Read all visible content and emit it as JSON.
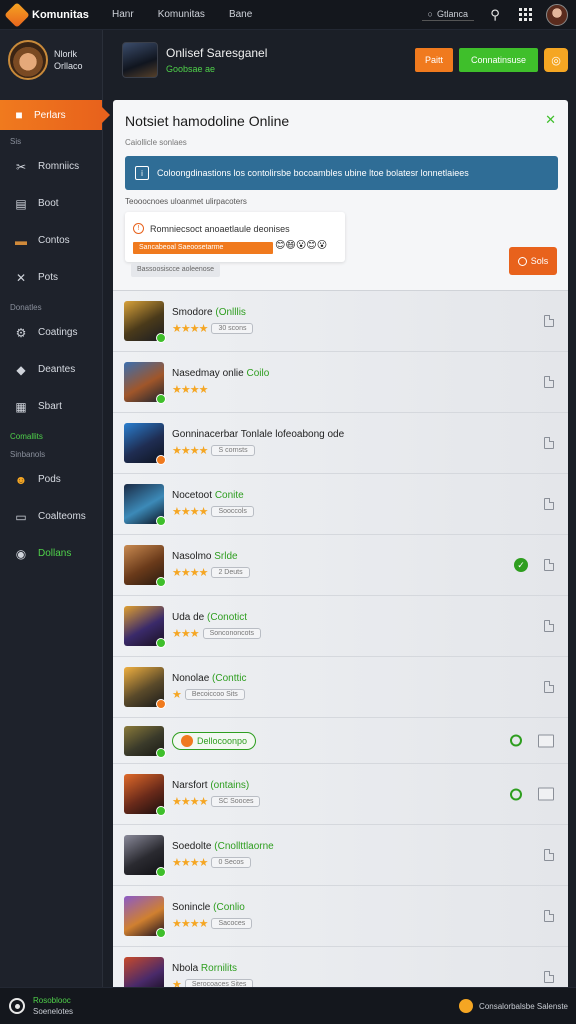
{
  "topbar": {
    "brand": "Komunitas",
    "nav": [
      "Hanr",
      "Komunitas",
      "Bane"
    ],
    "search_label": "Gtlanca"
  },
  "sidebar": {
    "profile_name_line1": "Nlorlk",
    "profile_name_line2": "Orllaco",
    "active_item": "Perlars",
    "section1": "Sis",
    "items_a": [
      {
        "label": "Romniics",
        "icon": "wrench-icon"
      },
      {
        "label": "Boot",
        "icon": "book-icon"
      },
      {
        "label": "Contos",
        "icon": "folder-icon"
      },
      {
        "label": "Pots",
        "icon": "tools-icon"
      }
    ],
    "section2": "Donatles",
    "items_b": [
      {
        "label": "Coatings",
        "icon": "gear-wrench-icon"
      },
      {
        "label": "Deantes",
        "icon": "tag-icon"
      },
      {
        "label": "Sbart",
        "icon": "chart-icon"
      }
    ],
    "section3": "Comallits",
    "section4": "Sinbanols",
    "items_c": [
      {
        "label": "Pods",
        "icon": "people-icon"
      },
      {
        "label": "Coalteoms",
        "icon": "card-icon"
      },
      {
        "label": "Dollans",
        "icon": "record-icon"
      }
    ]
  },
  "header": {
    "title": "Onlisef Saresganel",
    "subtitle": "Goobsae ae",
    "btn_orange": "Paitt",
    "btn_green": "Connatinsuse"
  },
  "modal": {
    "title": "Notsiet hamodoline Online",
    "subtitle": "Caiollicle sonlaes",
    "info_text": "Coloongdinastions los contolirsbe bocoambles ubine ltoe bolatesr lonnetlaiees",
    "note": "Teooocnoes uloanmet ulirpacoters",
    "notify_text": "Romniecsoct anoaetlaule deonises",
    "progress_label": "Sancabeoal Saeoosetarme",
    "tag": "Bassoosiscce aoleenose",
    "action_button": "Sols",
    "emojis": "😊😄😮😊😮"
  },
  "games": [
    {
      "title": "Smodore",
      "highlight": "(Onlllis",
      "stars": "★★★★",
      "pill": "30 scons",
      "right": "doc"
    },
    {
      "title": "Nasedmay onlie",
      "highlight": "Coilo",
      "stars": "★★★★",
      "pill": "",
      "right": "doc"
    },
    {
      "title": "Gonninacerbar Tonlale lofeoabong ode",
      "highlight": "",
      "stars": "★★★★",
      "pill": "S cornsts",
      "right": "doc"
    },
    {
      "title": "Nocetoot",
      "highlight": "Conite",
      "stars": "★★★★",
      "pill": "Sooccols",
      "right": "doc"
    },
    {
      "title": "Nasolmo",
      "highlight": "Srlde",
      "stars": "★★★★",
      "pill": "2 Deuts",
      "right": "check-doc"
    },
    {
      "title": "Uda de",
      "highlight": "(Conotict",
      "stars": "★★★",
      "pill": "Soncononcots",
      "right": "doc"
    },
    {
      "title": "Nonolae",
      "highlight": "(Conttic",
      "stars": "★",
      "pill": "Becoiccoo Sits",
      "right": "doc"
    },
    {
      "title": "",
      "highlight": "",
      "stars": "",
      "pill": "Dellocoonpo",
      "right": "ring-img",
      "special": true
    },
    {
      "title": "Narsfort",
      "highlight": "(ontains)",
      "stars": "★★★★",
      "pill": "SC Sooces",
      "right": "ring-img"
    },
    {
      "title": "Soedolte",
      "highlight": "(Cnollttlaorne",
      "stars": "★★★★",
      "pill": "0 Secos",
      "right": "doc"
    },
    {
      "title": "Sonincle",
      "highlight": "(Conlio",
      "stars": "★★★★",
      "pill": "Sacoces",
      "right": "doc"
    },
    {
      "title": "Nbola",
      "highlight": "Rornilits",
      "stars": "★",
      "pill": "Serocoaces Sites",
      "right": "doc"
    }
  ],
  "footer": {
    "left_line1": "Rosoblooc",
    "left_line2": "Soenelotes",
    "right_text": "Consalorbalsbe Salenste"
  }
}
